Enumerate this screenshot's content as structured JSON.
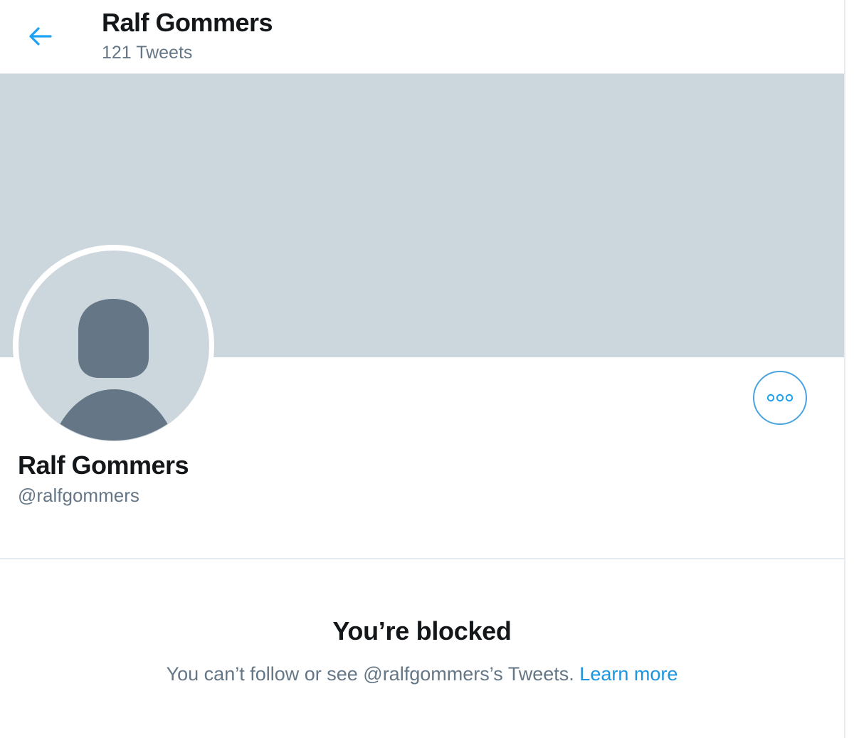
{
  "header": {
    "title": "Ralf Gommers",
    "subtitle": "121 Tweets"
  },
  "profile": {
    "name": "Ralf Gommers",
    "handle": "@ralfgommers"
  },
  "blocked": {
    "title": "You’re blocked",
    "message": "You can’t follow or see @ralfgommers’s Tweets.",
    "link": "Learn more"
  },
  "colors": {
    "accent": "#1da1f2",
    "banner": "#ccd6dd",
    "avatar_silhouette": "#657786",
    "text_primary": "#14171a",
    "text_secondary": "#657786"
  },
  "icons": {
    "back": "arrow-left-icon",
    "more": "more-horizontal-icon",
    "avatar": "default-profile-icon"
  }
}
